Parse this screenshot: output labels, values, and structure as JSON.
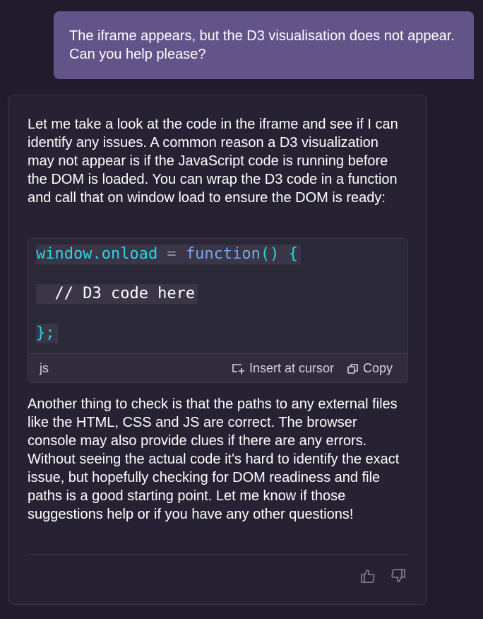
{
  "user_message": {
    "text": "The iframe appears, but the D3 visualisation does not appear. Can you help please?"
  },
  "assistant_message": {
    "paragraph_1": "Let me take a look at the code in the iframe and see if I can identify any issues. A common reason a D3 visualization may not appear is if the JavaScript code is running before the DOM is loaded. You can wrap the D3 code in a function and call that on window load to ensure the DOM is ready:",
    "code_block": {
      "line_1": {
        "ident": "window.onload",
        "op": " = ",
        "kw": "function",
        "rest": "() {"
      },
      "line_2": "  // D3 code here",
      "line_3": "};",
      "language": "js",
      "insert_label": "Insert at cursor",
      "copy_label": "Copy"
    },
    "paragraph_2": "Another thing to check is that the paths to any external files like the HTML, CSS and JS are correct. The browser console may also provide clues if there are any errors. Without seeing the actual code it's hard to identify the exact issue, but hopefully checking for DOM readiness and file paths is a good starting point. Let me know if those suggestions help or if you have any other questions!",
    "feedback": {
      "thumbs_up_icon": "thumbs-up-icon",
      "thumbs_down_icon": "thumbs-down-icon"
    }
  },
  "colors": {
    "background": "#201c2b",
    "user_bubble": "#625489",
    "assistant_card": "#262234",
    "code_ident": "#29d6e0",
    "code_keyword": "#7aa3f0"
  }
}
